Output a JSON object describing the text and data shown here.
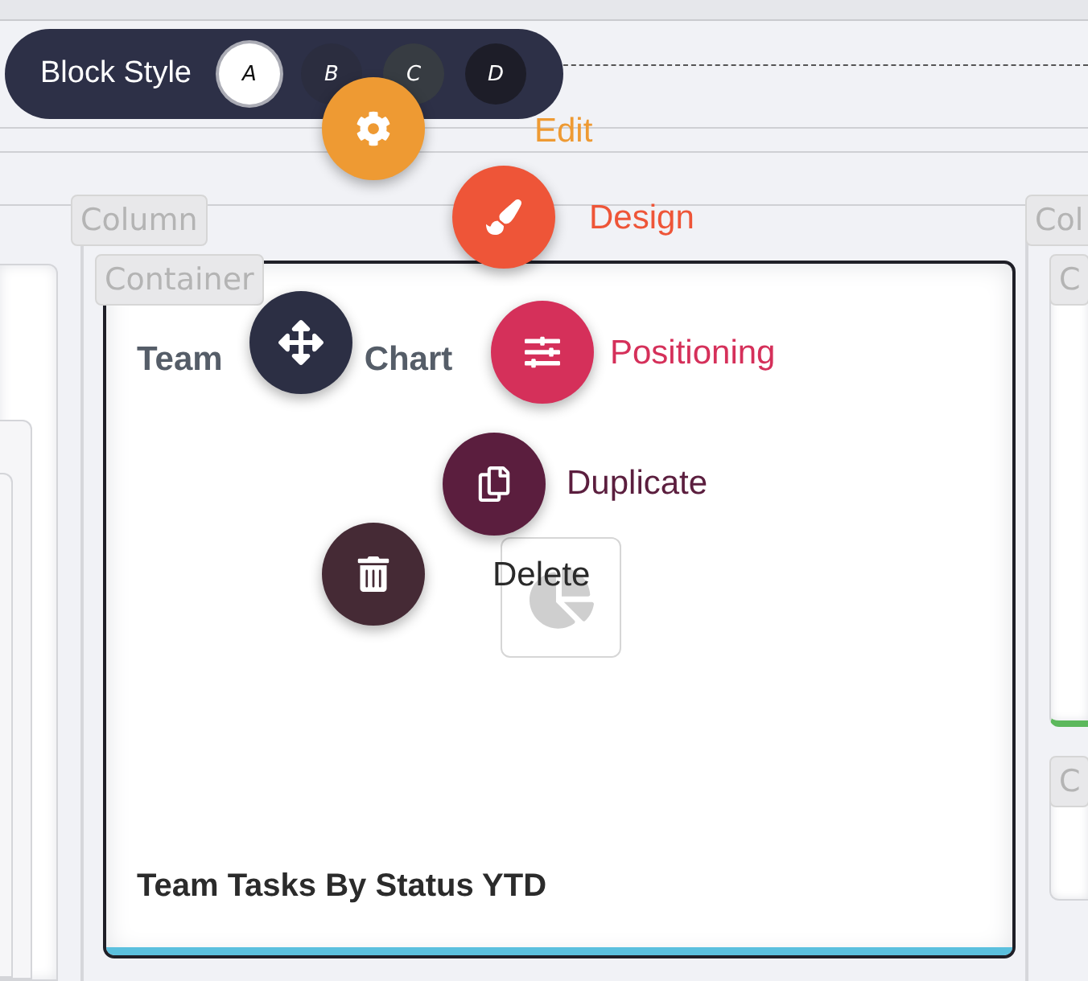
{
  "block_style": {
    "label": "Block Style",
    "options": [
      {
        "label": "A",
        "selected": true,
        "color": "#ffffff"
      },
      {
        "label": "B",
        "selected": false,
        "color": "#2b2d3f"
      },
      {
        "label": "C",
        "selected": false,
        "color": "#373c42"
      },
      {
        "label": "D",
        "selected": false,
        "color": "#1d1d28"
      }
    ]
  },
  "columns": [
    {
      "label": "Column"
    },
    {
      "label": "Col"
    }
  ],
  "containers": [
    {
      "label": "Container"
    },
    {
      "label": "C"
    },
    {
      "label": "C"
    }
  ],
  "card": {
    "title_start": "Team",
    "title_end": "Chart",
    "footer": "Team Tasks By Status YTD"
  },
  "actions": [
    {
      "kind": "edit",
      "label": "Edit",
      "color": "#ee9a33"
    },
    {
      "kind": "design",
      "label": "Design",
      "color": "#ee5538"
    },
    {
      "kind": "move",
      "color": "#2c2f44"
    },
    {
      "kind": "positioning",
      "label": "Positioning",
      "color": "#d5305a"
    },
    {
      "kind": "duplicate",
      "label": "Duplicate",
      "color": "#5b1e3e"
    },
    {
      "kind": "delete",
      "label": "Delete",
      "color": "#452a35"
    }
  ]
}
